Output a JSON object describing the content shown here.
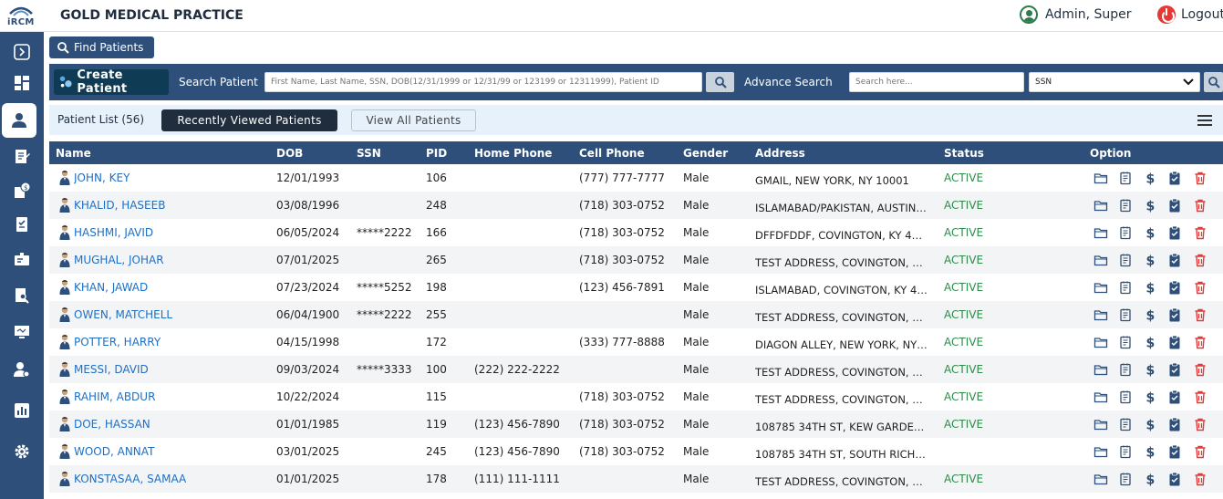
{
  "brand": {
    "logo_text": "iRCM",
    "title": "GOLD MEDICAL PRACTICE"
  },
  "header": {
    "user_name": "Admin, Super",
    "logout_label": "Logout"
  },
  "colors": {
    "primary": "#2d4f7a",
    "dark": "#1f2d3d",
    "active_status": "#2e8b4b",
    "link": "#1f6fc4",
    "delete": "#e53935"
  },
  "sidebar": {
    "items": [
      "expand-icon",
      "dashboard-icon",
      "patient-icon",
      "notes-icon",
      "billing-icon",
      "checklist-icon",
      "claims-icon",
      "document-icon",
      "monitor-icon",
      "user-settings-icon",
      "reports-icon",
      "settings-icon"
    ],
    "active": "patient-icon"
  },
  "find_patients": {
    "label": "Find Patients"
  },
  "search": {
    "create_label": "Create Patient",
    "search_label": "Search Patient",
    "search_placeholder": "First Name, Last Name, SSN, DOB(12/31/1999 or 12/31/99 or 123199 or 12311999), Patient ID",
    "advance_label": "Advance Search",
    "advance_placeholder": "Search here...",
    "advance_field": "SSN"
  },
  "list": {
    "title": "Patient List (56)",
    "tab_recent": "Recently Viewed Patients",
    "tab_all": "View All Patients"
  },
  "table": {
    "columns": [
      "Name",
      "DOB",
      "SSN",
      "PID",
      "Home Phone",
      "Cell Phone",
      "Gender",
      "Address",
      "Status",
      "Option"
    ],
    "rows": [
      {
        "name": "JOHN, KEY",
        "dob": "12/01/1993",
        "ssn": "",
        "pid": "106",
        "home": "",
        "cell": "(777) 777-7777",
        "gender": "Male",
        "address": "GMAIL, NEW YORK, NY 10001",
        "status": "ACTIVE"
      },
      {
        "name": "KHALID, HASEEB",
        "dob": "03/08/1996",
        "ssn": "",
        "pid": "248",
        "home": "",
        "cell": "(718) 303-0752",
        "gender": "Male",
        "address": "ISLAMABAD/PAKISTAN, AUSTIN,...",
        "status": "ACTIVE"
      },
      {
        "name": "HASHMI, JAVID",
        "dob": "06/05/2024",
        "ssn": "*****2222",
        "pid": "166",
        "home": "",
        "cell": "(718) 303-0752",
        "gender": "Male",
        "address": "DFFDFDDF, COVINGTON, KY 410...",
        "status": "ACTIVE"
      },
      {
        "name": "MUGHAL, JOHAR",
        "dob": "07/01/2025",
        "ssn": "",
        "pid": "265",
        "home": "",
        "cell": "(718) 303-0752",
        "gender": "Male",
        "address": "TEST ADDRESS, COVINGTON, K...",
        "status": "ACTIVE"
      },
      {
        "name": "KHAN, JAWAD",
        "dob": "07/23/2024",
        "ssn": "*****5252",
        "pid": "198",
        "home": "",
        "cell": "(123) 456-7891",
        "gender": "Male",
        "address": "ISLAMABAD, COVINGTON, KY 41...",
        "status": "ACTIVE"
      },
      {
        "name": "OWEN, MATCHELL",
        "dob": "06/04/1900",
        "ssn": "*****2222",
        "pid": "255",
        "home": "",
        "cell": "",
        "gender": "Male",
        "address": "TEST ADDRESS, COVINGTON, K...",
        "status": "ACTIVE"
      },
      {
        "name": "POTTER, HARRY",
        "dob": "04/15/1998",
        "ssn": "",
        "pid": "172",
        "home": "",
        "cell": "(333) 777-8888",
        "gender": "Male",
        "address": "DIAGON ALLEY, NEW YORK, NY 1...",
        "status": "ACTIVE"
      },
      {
        "name": "MESSI, DAVID",
        "dob": "09/03/2024",
        "ssn": "*****3333",
        "pid": "100",
        "home": "(222) 222-2222",
        "cell": "",
        "gender": "Male",
        "address": "TEST ADDRESS, COVINGTON, K...",
        "status": "ACTIVE"
      },
      {
        "name": "RAHIM, ABDUR",
        "dob": "10/22/2024",
        "ssn": "",
        "pid": "115",
        "home": "",
        "cell": "(718) 303-0752",
        "gender": "Male",
        "address": "TEST ADDRESS, COVINGTON, K...",
        "status": "ACTIVE"
      },
      {
        "name": "DOE, HASSAN",
        "dob": "01/01/1985",
        "ssn": "",
        "pid": "119",
        "home": "(123) 456-7890",
        "cell": "(718) 303-0752",
        "gender": "Male",
        "address": "108785 34TH ST, KEW GARDEN...",
        "status": "ACTIVE"
      },
      {
        "name": "WOOD, ANNAT",
        "dob": "03/01/2025",
        "ssn": "",
        "pid": "245",
        "home": "(123) 456-7890",
        "cell": "(718) 303-0752",
        "gender": "Male",
        "address": "108785 34TH ST, SOUTH RICHM...",
        "status": ""
      },
      {
        "name": "KONSTASAA, SAMAA",
        "dob": "01/01/2025",
        "ssn": "",
        "pid": "178",
        "home": "(111) 111-1111",
        "cell": "",
        "gender": "Male",
        "address": "TEST ADDRESS, COVINGTON, K...",
        "status": "ACTIVE"
      }
    ],
    "row_options": [
      "folder-icon",
      "notes-icon",
      "dollar-icon",
      "clipboard-icon",
      "trash-icon"
    ]
  }
}
